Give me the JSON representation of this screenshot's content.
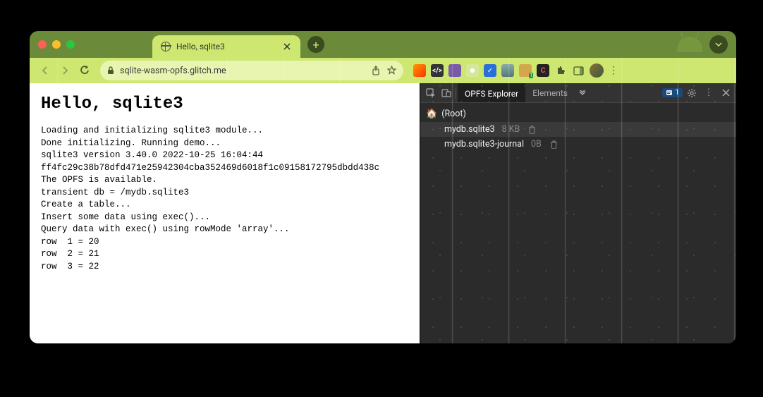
{
  "tab": {
    "title": "Hello, sqlite3"
  },
  "url": "sqlite-wasm-opfs.glitch.me",
  "page": {
    "heading": "Hello, sqlite3",
    "log": [
      "Loading and initializing sqlite3 module...",
      "Done initializing. Running demo...",
      "sqlite3 version 3.40.0 2022-10-25 16:04:44",
      "ff4fc29c38b78dfd471e25942304cba352469d6018f1c09158172795dbdd438c",
      "The OPFS is available.",
      "transient db = /mydb.sqlite3",
      "Create a table...",
      "Insert some data using exec()...",
      "Query data with exec() using rowMode 'array'...",
      "row  1 = 20",
      "row  2 = 21",
      "row  3 = 22"
    ]
  },
  "devtools": {
    "tabs": {
      "active": "OPFS Explorer",
      "other": "Elements"
    },
    "badge_count": "1",
    "root_label": "(Root)",
    "files": [
      {
        "name": "mydb.sqlite3",
        "size": "8 KB"
      },
      {
        "name": "mydb.sqlite3-journal",
        "size": "0B"
      }
    ]
  }
}
